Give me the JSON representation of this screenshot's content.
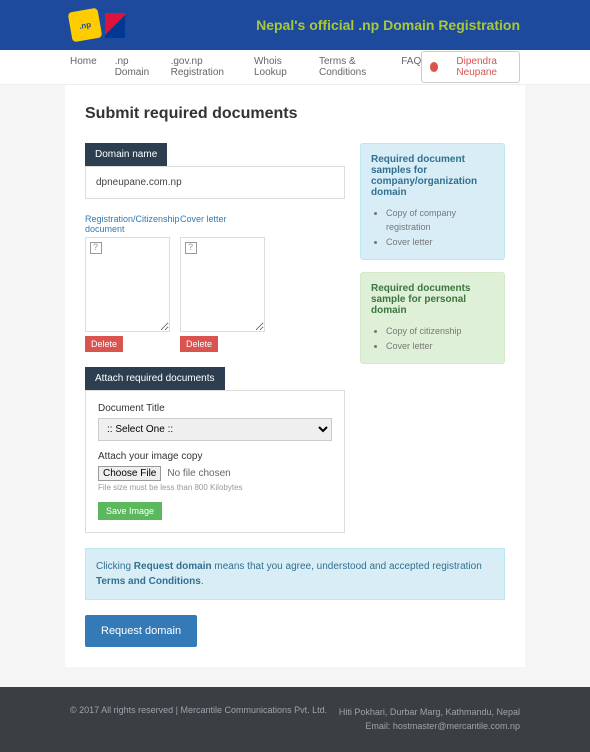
{
  "header": {
    "title": "Nepal's official .np Domain Registration",
    "logo_text": ".np"
  },
  "nav": {
    "items": [
      "Home",
      ".np Domain",
      ".gov.np Registration",
      "Whois Lookup",
      "Terms & Conditions",
      "FAQ"
    ],
    "user": "Dipendra Neupane"
  },
  "page": {
    "title": "Submit required documents",
    "domain_header": "Domain name",
    "domain_value": "dpneupane.com.np"
  },
  "docs": {
    "card1_title": "Registration/Citizenship document",
    "card2_title": "Cover letter",
    "delete_label": "Delete"
  },
  "attach": {
    "header": "Attach required documents",
    "title_label": "Document Title",
    "select_placeholder": ":: Select One ::",
    "upload_label": "Attach your image copy",
    "choose_label": "Choose File",
    "no_file": "No file chosen",
    "hint": "File size must be less than 800 Kilobytes",
    "save_label": "Save Image"
  },
  "samples": {
    "company_title": "Required document samples for company/organization domain",
    "company_items": [
      "Copy of company registration",
      "Cover letter"
    ],
    "personal_title": "Required documents sample for personal domain",
    "personal_items": [
      "Copy of citizenship",
      "Cover letter"
    ]
  },
  "agree": {
    "pre": "Clicking ",
    "b1": "Request domain",
    "mid": " means that you agree, understood and accepted registration ",
    "b2": "Terms and Conditions",
    "post": "."
  },
  "request_label": "Request domain",
  "footer": {
    "left": "© 2017 All rights reserved | Mercantile Communications Pvt. Ltd.",
    "addr": "Hiti Pokhari, Durbar Marg, Kathmandu, Nepal",
    "email": "Email: hostmaster@mercantile.com.np"
  }
}
